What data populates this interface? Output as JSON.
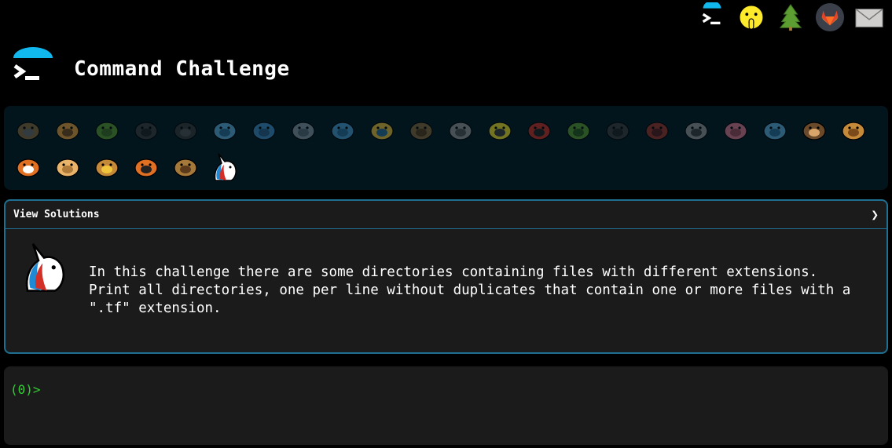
{
  "app": {
    "title": "Command Challenge"
  },
  "nav": {
    "items": [
      {
        "icon": "terminal-logo-icon"
      },
      {
        "icon": "shushing-face-icon"
      },
      {
        "icon": "evergreen-tree-icon"
      },
      {
        "icon": "gitlab-icon"
      },
      {
        "icon": "envelope-icon"
      }
    ]
  },
  "animals": [
    {
      "icon": "snail-icon"
    },
    {
      "icon": "butterfly-icon"
    },
    {
      "icon": "caterpillar-icon"
    },
    {
      "icon": "ant-icon"
    },
    {
      "icon": "ship-wheel-icon"
    },
    {
      "icon": "whale-icon"
    },
    {
      "icon": "dolphin-icon"
    },
    {
      "icon": "shark-icon"
    },
    {
      "icon": "fish-icon"
    },
    {
      "icon": "tropical-fish-icon"
    },
    {
      "icon": "blowfish-icon"
    },
    {
      "icon": "wolf-icon"
    },
    {
      "icon": "bee-icon"
    },
    {
      "icon": "ladybug-icon"
    },
    {
      "icon": "cricket-icon"
    },
    {
      "icon": "spider-icon"
    },
    {
      "icon": "scorpion-icon"
    },
    {
      "icon": "fly-icon"
    },
    {
      "icon": "worm-icon"
    },
    {
      "icon": "microbe-icon"
    },
    {
      "icon": "monkey-icon"
    },
    {
      "icon": "dog-icon"
    },
    {
      "icon": "fox-icon"
    },
    {
      "icon": "hamster-icon"
    },
    {
      "icon": "lion-icon"
    },
    {
      "icon": "tiger-icon"
    },
    {
      "icon": "horse-icon"
    },
    {
      "icon": "unicorn-icon"
    }
  ],
  "challenge": {
    "solutions_label": "View Solutions",
    "chevron": "❯",
    "description": "In this challenge there are some directories containing files with different extensions.\nPrint all directories, one per line without duplicates that contain one or more files with a\n\".tf\" extension."
  },
  "terminal": {
    "prompt": "(0)>"
  },
  "colors": {
    "accent": "#1e6f92",
    "prompt": "#2fd02f",
    "logo_arc": "#11b8ee"
  }
}
